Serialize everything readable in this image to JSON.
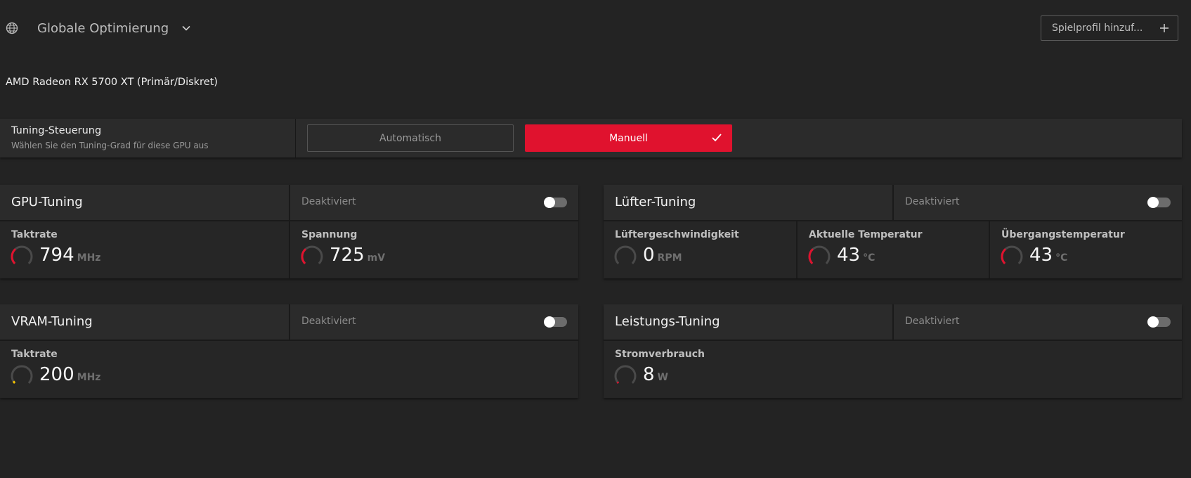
{
  "header": {
    "profile_selector": "Globale Optimierung",
    "add_profile_button": "Spielprofil hinzuf..."
  },
  "gpu_name": "AMD Radeon RX 5700 XT (Primär/Diskret)",
  "tuning_control": {
    "title": "Tuning-Steuerung",
    "subtitle": "Wählen Sie den Tuning-Grad für diese GPU aus",
    "options": {
      "auto": "Automatisch",
      "manual": "Manuell"
    },
    "selected": "Manuell"
  },
  "sections": {
    "gpu": {
      "title": "GPU-Tuning",
      "status": "Deaktiviert",
      "enabled": false,
      "metrics": [
        {
          "label": "Taktrate",
          "value": "794",
          "unit": "MHz",
          "level": 0.35,
          "color": "#e0122e"
        },
        {
          "label": "Spannung",
          "value": "725",
          "unit": "mV",
          "level": 0.35,
          "color": "#e0122e"
        }
      ]
    },
    "fan": {
      "title": "Lüfter-Tuning",
      "status": "Deaktiviert",
      "enabled": false,
      "metrics": [
        {
          "label": "Lüftergeschwindigkeit",
          "value": "0",
          "unit": "RPM",
          "level": 0,
          "color": "#e0122e"
        },
        {
          "label": "Aktuelle Temperatur",
          "value": "43",
          "unit": "°C",
          "level": 0.35,
          "color": "#e0122e"
        },
        {
          "label": "Übergangstemperatur",
          "value": "43",
          "unit": "°C",
          "level": 0.35,
          "color": "#e0122e"
        }
      ]
    },
    "vram": {
      "title": "VRAM-Tuning",
      "status": "Deaktiviert",
      "enabled": false,
      "metrics": [
        {
          "label": "Taktrate",
          "value": "200",
          "unit": "MHz",
          "level": 0.05,
          "color": "#f2c200"
        }
      ]
    },
    "power": {
      "title": "Leistungs-Tuning",
      "status": "Deaktiviert",
      "enabled": false,
      "metrics": [
        {
          "label": "Stromverbrauch",
          "value": "8",
          "unit": "W",
          "level": 0.03,
          "color": "#e0122e"
        }
      ]
    }
  },
  "colors": {
    "accent": "#e0122e",
    "panel": "#2b2b2b",
    "background": "#232323",
    "toggle_off": "#6c6c6c"
  }
}
